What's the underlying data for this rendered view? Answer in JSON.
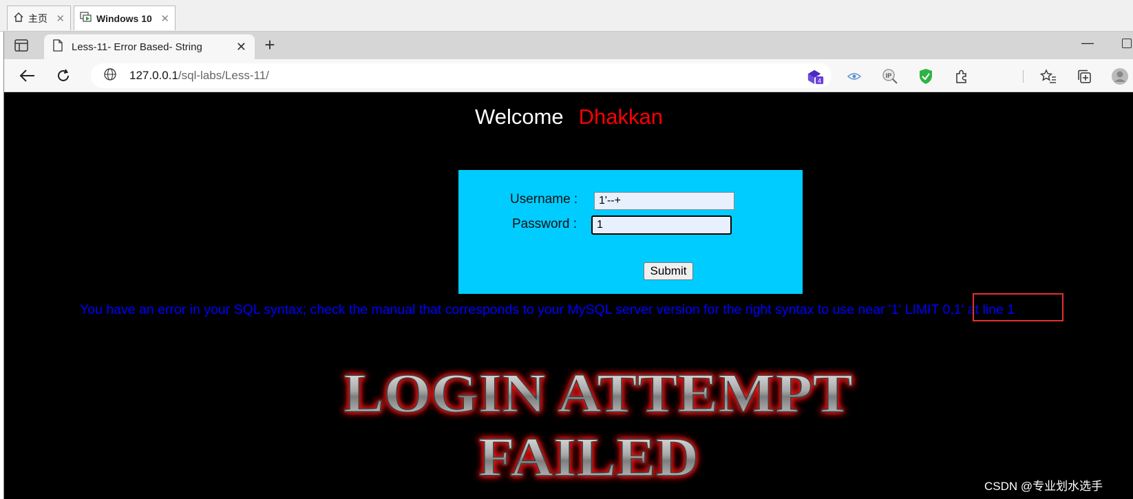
{
  "vm_tabs": [
    {
      "label": "主页",
      "icon": "home-icon"
    },
    {
      "label": "Windows 10",
      "icon": "vm-icon"
    }
  ],
  "browser": {
    "tab_title": "Less-11- Error Based- String",
    "address_host": "127.0.0.1",
    "address_path": "/sql-labs/Less-11/",
    "extension_badge": "4"
  },
  "page": {
    "welcome": "Welcome",
    "username_display": "Dhakkan",
    "form": {
      "username_label": "Username :",
      "username_value": "1'--+",
      "password_label": "Password :",
      "password_value": "1",
      "submit_label": "Submit"
    },
    "error_text": "You have an error in your SQL syntax; check the manual that corresponds to your MySQL server version for the right syntax to use near '1' LIMIT 0,1' at line 1",
    "fail_line1": "LOGIN ATTEMPT",
    "fail_line2": "FAILED"
  },
  "watermark": "CSDN @专业划水选手",
  "colors": {
    "page_bg": "#000000",
    "login_box": "#00ccff",
    "error_text": "#0000ff",
    "username_highlight": "#ff0000",
    "annotation_box": "#e8302a"
  }
}
